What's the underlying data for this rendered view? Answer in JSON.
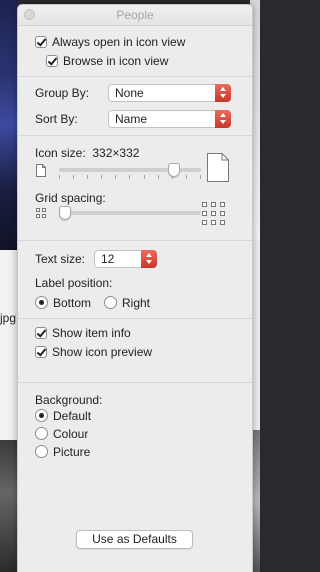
{
  "window": {
    "title": "People"
  },
  "background": {
    "partial_filename": "jpg"
  },
  "view_options": {
    "always_open_icon_view": {
      "label": "Always open in icon view",
      "checked": true
    },
    "browse_icon_view": {
      "label": "Browse in icon view",
      "checked": true
    },
    "group_by": {
      "label": "Group By:",
      "value": "None"
    },
    "sort_by": {
      "label": "Sort By:",
      "value": "Name"
    },
    "icon_size": {
      "label": "Icon size:",
      "value_text": "332×332",
      "slider_fraction": 0.84
    },
    "grid_spacing": {
      "label": "Grid spacing:",
      "slider_fraction": 0.0
    },
    "text_size": {
      "label": "Text size:",
      "value": "12"
    },
    "label_position": {
      "label": "Label position:",
      "options": [
        {
          "label": "Bottom",
          "selected": true
        },
        {
          "label": "Right",
          "selected": false
        }
      ]
    },
    "show_item_info": {
      "label": "Show item info",
      "checked": true
    },
    "show_icon_preview": {
      "label": "Show icon preview",
      "checked": true
    },
    "background": {
      "label": "Background:",
      "options": [
        {
          "label": "Default",
          "selected": true
        },
        {
          "label": "Colour",
          "selected": false
        },
        {
          "label": "Picture",
          "selected": false
        }
      ]
    },
    "defaults_button": "Use as Defaults"
  },
  "colors": {
    "popup_accent": "#d9473a",
    "panel_bg": "#ececec"
  }
}
